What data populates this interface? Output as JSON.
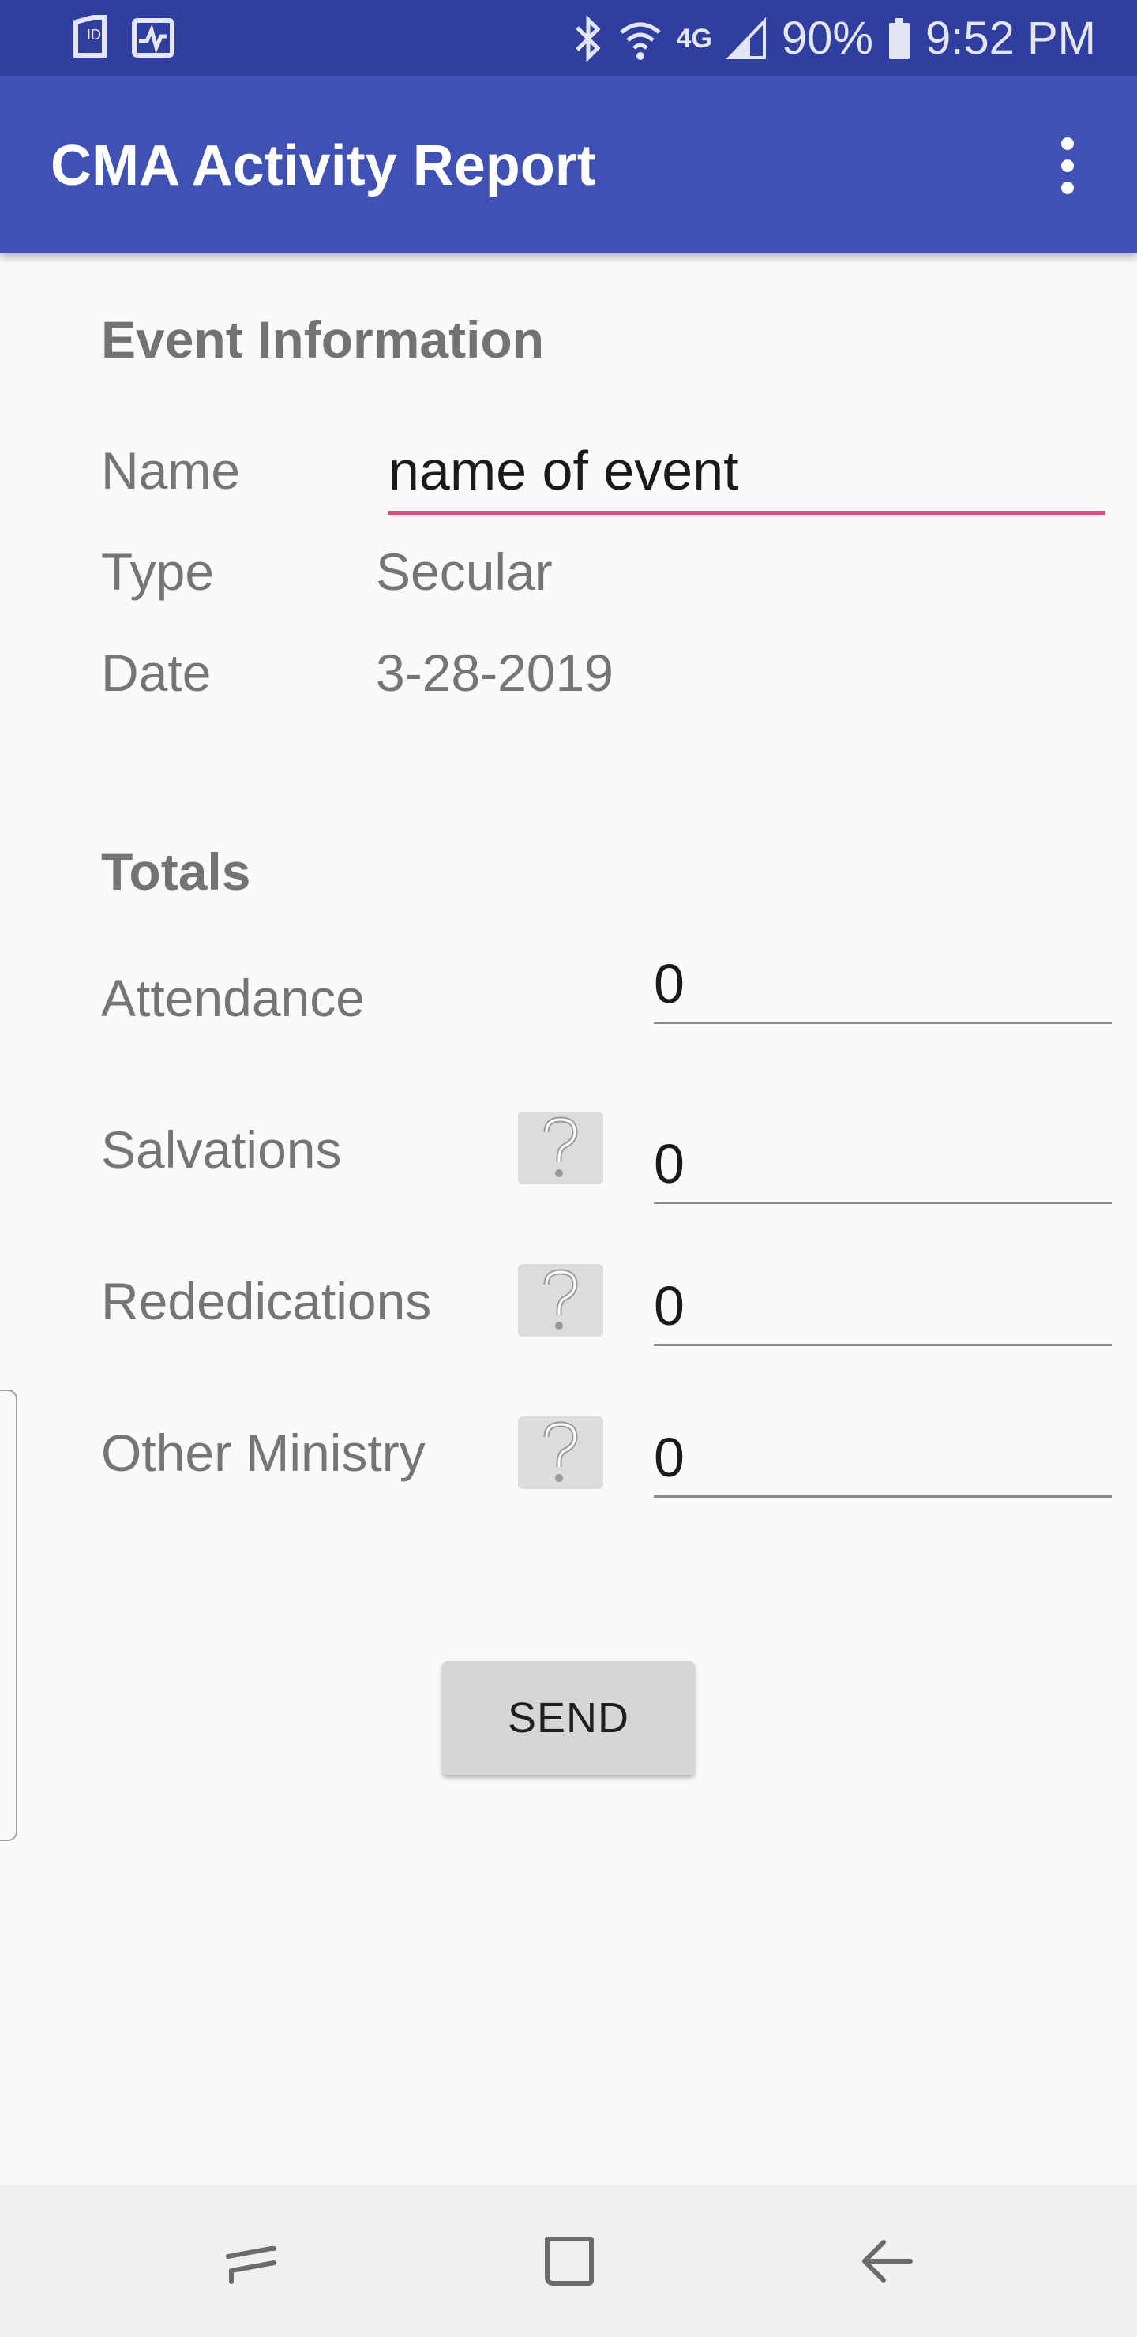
{
  "status_bar": {
    "battery": "90%",
    "time": "9:52 PM",
    "network": "4G"
  },
  "app_bar": {
    "title": "CMA Activity Report",
    "menu_icon": "more-vert-icon"
  },
  "event_info": {
    "heading": "Event Information",
    "name_label": "Name",
    "name_value": "name of event",
    "type_label": "Type",
    "type_value": "Secular",
    "date_label": "Date",
    "date_value": "3-28-2019"
  },
  "totals": {
    "heading": "Totals",
    "rows": [
      {
        "label": "Attendance",
        "value": "0",
        "has_help": false
      },
      {
        "label": "Salvations",
        "value": "0",
        "has_help": true
      },
      {
        "label": "Rededications",
        "value": "0",
        "has_help": true
      },
      {
        "label": "Other Ministry",
        "value": "0",
        "has_help": true
      }
    ]
  },
  "send_button": {
    "label": "SEND"
  },
  "colors": {
    "status_bar": "#303f9f",
    "app_bar": "#3f51b5",
    "accent_underline": "#e64980"
  },
  "nav_bar": {
    "icons": [
      "recents-icon",
      "home-icon",
      "back-icon"
    ]
  }
}
